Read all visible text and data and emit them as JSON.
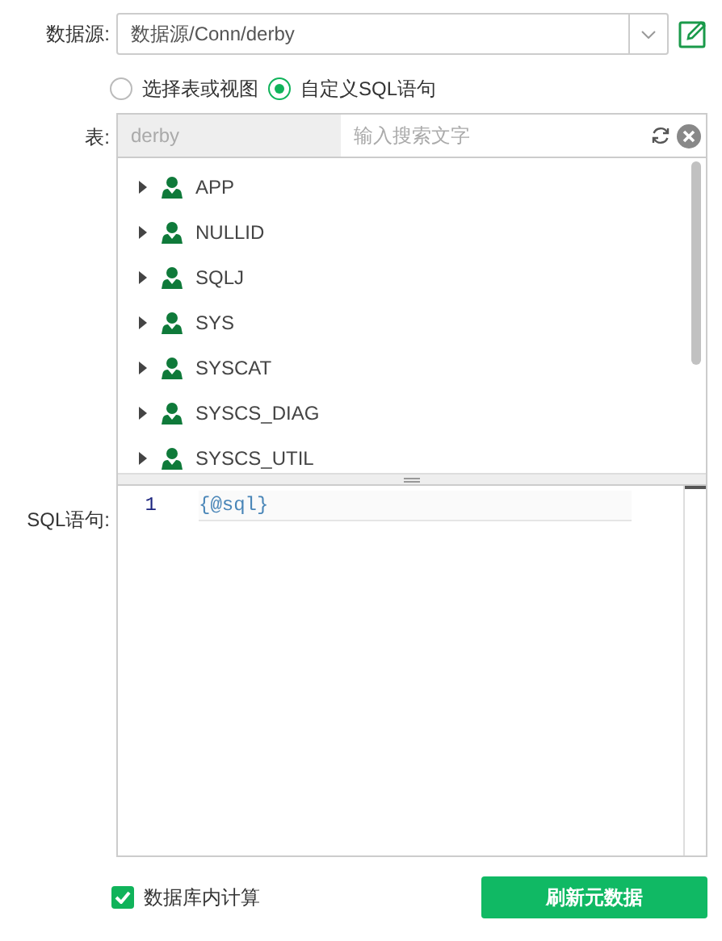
{
  "datasource": {
    "label": "数据源:",
    "value": "数据源/Conn/derby"
  },
  "mode_options": [
    {
      "label": "选择表或视图",
      "selected": false
    },
    {
      "label": "自定义SQL语句",
      "selected": true
    }
  ],
  "table": {
    "label": "表:",
    "schema": "derby",
    "search_placeholder": "输入搜索文字",
    "items": [
      {
        "name": "APP",
        "expanded": false
      },
      {
        "name": "NULLID",
        "expanded": false
      },
      {
        "name": "SQLJ",
        "expanded": false
      },
      {
        "name": "SYS",
        "expanded": false
      },
      {
        "name": "SYSCAT",
        "expanded": false
      },
      {
        "name": "SYSCS_DIAG",
        "expanded": false
      },
      {
        "name": "SYSCS_UTIL",
        "expanded": false
      }
    ]
  },
  "sql": {
    "label": "SQL语句:",
    "lines": [
      {
        "number": "1",
        "code": "{@sql}"
      }
    ]
  },
  "in_db_compute": {
    "label": "数据库内计算",
    "checked": true
  },
  "refresh_button": "刷新元数据"
}
